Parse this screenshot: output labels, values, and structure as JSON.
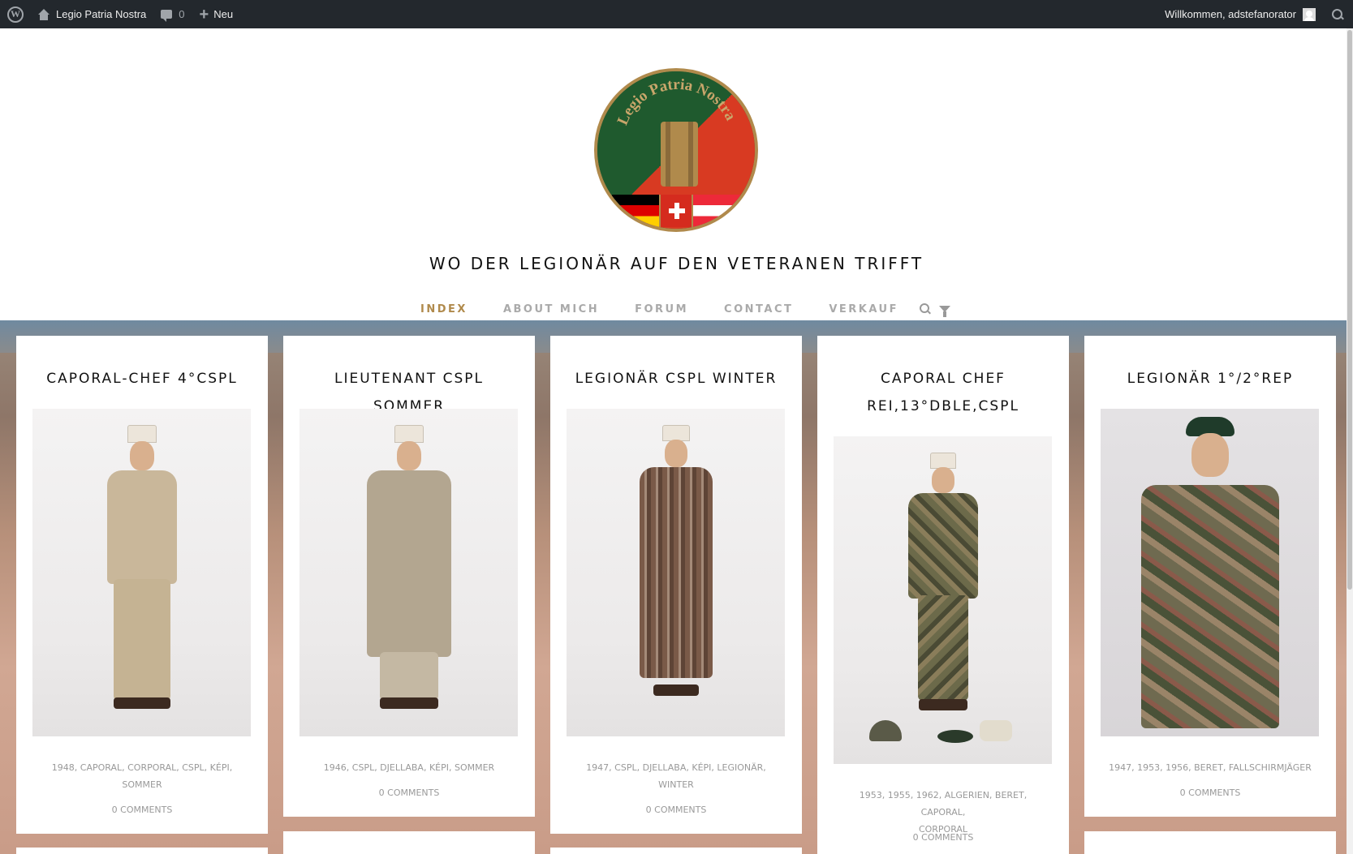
{
  "adminbar": {
    "site_name": "Legio Patria Nostra",
    "comments_count": "0",
    "new_label": "Neu",
    "welcome": "Willkommen, adstefanorator"
  },
  "header": {
    "logo_text": "Legio Patria Nostra",
    "tagline": "WO DER LEGIONÄR AUF DEN VETERANEN TRIFFT"
  },
  "nav": {
    "items": [
      {
        "label": "INDEX"
      },
      {
        "label": "ABOUT MICH"
      },
      {
        "label": "FORUM"
      },
      {
        "label": "CONTACT"
      },
      {
        "label": "VERKAUF"
      }
    ]
  },
  "posts": [
    {
      "title_lines": [
        "CAPORAL-CHEF 4°CSPL"
      ],
      "tags_line1": "1948, CAPORAL, CORPORAL, CSPL, KÉPI,",
      "tags_line2": "SOMMER",
      "comments": "0 COMMENTS",
      "uniform_color": "#c9b79a",
      "cap_color": "#ece5da"
    },
    {
      "title_lines": [
        "LIEUTENANT CSPL SOMMER"
      ],
      "tags_line1": "1946, CSPL, DJELLABA, KÉPI, SOMMER",
      "tags_line2": "",
      "comments": "0 COMMENTS",
      "uniform_color": "#b3a690",
      "cap_color": "#ece5da"
    },
    {
      "title_lines": [
        "LEGIONÄR CSPL WINTER"
      ],
      "tags_line1": "1947, CSPL, DJELLABA, KÉPI, LEGIONÄR,",
      "tags_line2": "WINTER",
      "comments": "0 COMMENTS",
      "uniform_color": "#7a5a48",
      "cap_color": "#ece5da"
    },
    {
      "title_lines": [
        "CAPORAL CHEF",
        "REI,13°DBLE,CSPL"
      ],
      "tags_line1": "1953, 1955, 1962, ALGERIEN, BERET, CAPORAL,",
      "tags_line2": "CORPORAL",
      "comments": "0 COMMENTS",
      "uniform_color": "#6c6a4a",
      "cap_color": "#ece5da"
    },
    {
      "title_lines": [
        "LEGIONÄR 1°/2°REP"
      ],
      "tags_line1": "1947, 1953, 1956, BERET, FALLSCHIRMJÄGER",
      "tags_line2": "",
      "comments": "0 COMMENTS",
      "uniform_color": "#6f6a50",
      "cap_color": "#1f3b2a"
    }
  ],
  "colors": {
    "accent": "#b08a4c",
    "adminbar": "#23282d",
    "nav_inactive": "#aaaaaa"
  }
}
